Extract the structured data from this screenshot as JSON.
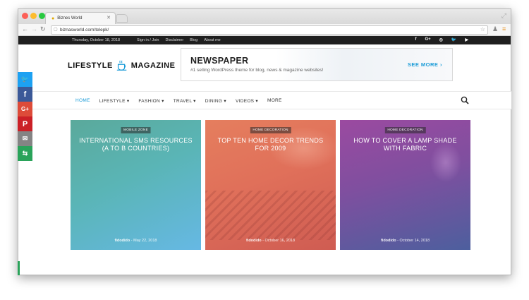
{
  "browser": {
    "tab_title": "Biznes World",
    "url": "biznasworld.com/telepk/"
  },
  "topbar": {
    "date": "Thursday, October 18, 2018",
    "links": [
      "Sign in / Join",
      "Disclaimer",
      "Blog",
      "About me"
    ],
    "social": [
      "facebook-icon",
      "google-plus-icon",
      "instagram-icon",
      "twitter-icon",
      "youtube-icon"
    ]
  },
  "header": {
    "logo_left": "LIFESTYLE",
    "logo_right": "MAGAZINE",
    "ad": {
      "title": "NEWSPAPER",
      "subtitle": "#1 selling WordPress theme for blog, news & magazine websites!",
      "cta": "SEE MORE ›"
    }
  },
  "nav": {
    "items": [
      {
        "label": "HOME",
        "active": true
      },
      {
        "label": "LIFESTYLE ▾"
      },
      {
        "label": "FASHION ▾"
      },
      {
        "label": "TRAVEL ▾"
      },
      {
        "label": "DINING ▾"
      },
      {
        "label": "VIDEOS ▾"
      },
      {
        "label": "MORE"
      }
    ]
  },
  "cards": [
    {
      "category": "MOBILE ZONE",
      "title": "INTERNATIONAL SMS RESOURCES (A TO B COUNTRIES)",
      "author": "fidodido",
      "date": "May 22, 2018"
    },
    {
      "category": "HOME DECORATION",
      "title": "TOP TEN HOME DECOR TRENDS FOR 2009",
      "author": "fidodido",
      "date": "October 16, 2018"
    },
    {
      "category": "HOME DECORATION",
      "title": "HOW TO COVER A LAMP SHADE WITH FABRIC",
      "author": "fidodido",
      "date": "October 14, 2018"
    }
  ],
  "share": [
    {
      "icon": "twitter-icon",
      "color": "#1da1f2"
    },
    {
      "icon": "facebook-icon",
      "color": "#3b5998"
    },
    {
      "icon": "google-plus-icon",
      "color": "#dd4b39"
    },
    {
      "icon": "pinterest-icon",
      "color": "#cb2027"
    },
    {
      "icon": "email-icon",
      "color": "#848484"
    },
    {
      "icon": "more-share-icon",
      "color": "#2aa35a"
    }
  ]
}
